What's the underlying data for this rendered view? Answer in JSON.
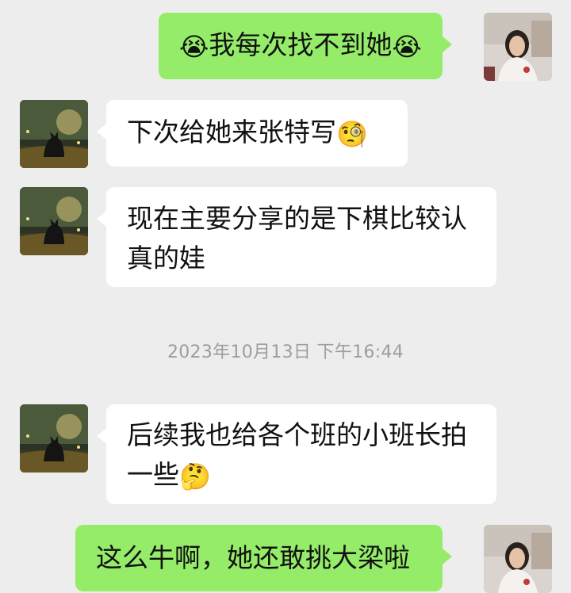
{
  "messages": [
    {
      "direction": "out",
      "text": "我每次找不到她",
      "emoji_before": "😭",
      "emoji_after": "😭"
    },
    {
      "direction": "in",
      "text": "下次给她来张特写",
      "emoji_after": "🧐"
    },
    {
      "direction": "in",
      "text": "现在主要分享的是下棋比较认真的娃"
    },
    {
      "direction": "in",
      "text": "后续我也给各个班的小班长拍一些",
      "emoji_after": "🤔"
    },
    {
      "direction": "out",
      "text": "这么牛啊，她还敢挑大梁啦"
    }
  ],
  "timestamp": "2023年10月13日 下午16:44",
  "colors": {
    "background": "#ededed",
    "incoming_bubble": "#ffffff",
    "outgoing_bubble": "#95ec69",
    "timestamp": "#9d9d9d"
  },
  "icons": {
    "incoming_avatar": "cat-silhouette-avatar",
    "outgoing_avatar": "woman-portrait-avatar"
  }
}
